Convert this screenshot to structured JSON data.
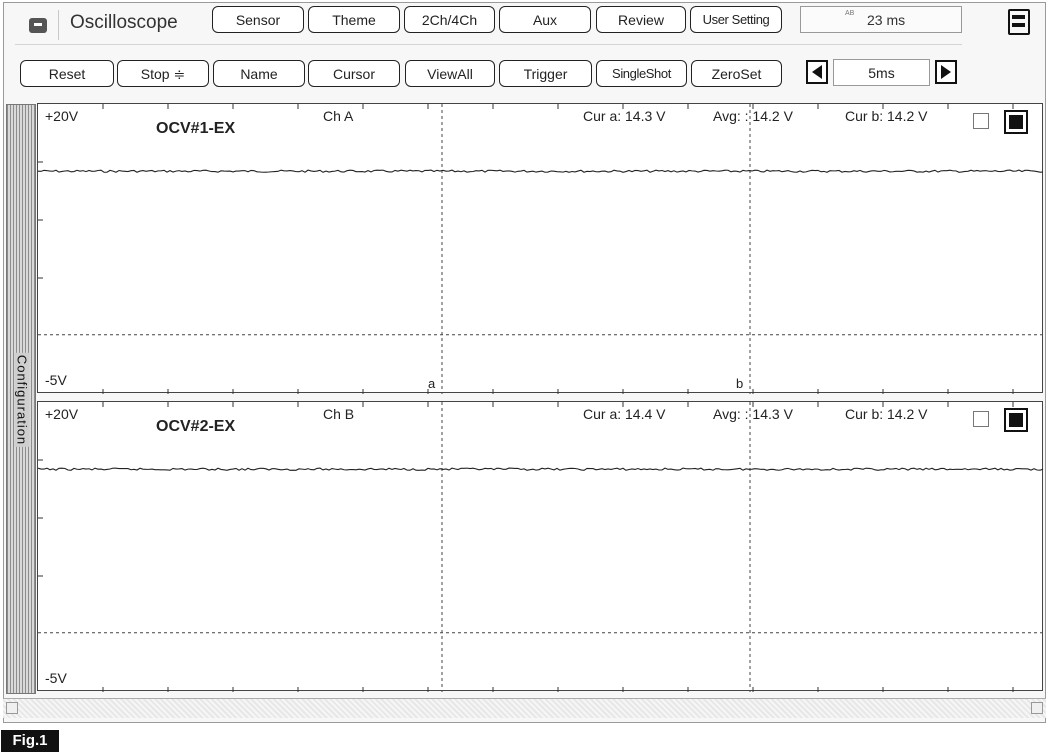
{
  "app": {
    "title": "Oscilloscope"
  },
  "toolbar_top": [
    {
      "id": "sensor",
      "label": "Sensor"
    },
    {
      "id": "theme",
      "label": "Theme"
    },
    {
      "id": "2ch4ch",
      "label": "2Ch/4Ch"
    },
    {
      "id": "aux",
      "label": "Aux"
    },
    {
      "id": "review",
      "label": "Review"
    },
    {
      "id": "user-setting",
      "label": "User Setting"
    }
  ],
  "time_readout": {
    "prefix": "AB",
    "value": "23 ms"
  },
  "toolbar_bottom": [
    {
      "id": "reset",
      "label": "Reset"
    },
    {
      "id": "stop",
      "label": "Stop ≑"
    },
    {
      "id": "name",
      "label": "Name"
    },
    {
      "id": "cursor",
      "label": "Cursor"
    },
    {
      "id": "viewall",
      "label": "ViewAll"
    },
    {
      "id": "trigger",
      "label": "Trigger"
    },
    {
      "id": "singleshot",
      "label": "SingleShot"
    },
    {
      "id": "zeroset",
      "label": "ZeroSet"
    }
  ],
  "timebase": {
    "value": "5ms"
  },
  "sidebar": {
    "label": "Configuration"
  },
  "channels": [
    {
      "name": "OCV#1-EX",
      "channel": "Ch A",
      "ymax": "+20V",
      "ymin": "-5V",
      "cur_a": "Cur a: 14.3 V",
      "avg": "Avg: : 14.2 V",
      "cur_b": "Cur b: 14.2 V",
      "cursor_a_label": "a",
      "cursor_b_label": "b",
      "signal_level": 14.3
    },
    {
      "name": "OCV#2-EX",
      "channel": "Ch B",
      "ymax": "+20V",
      "ymin": "-5V",
      "cur_a": "Cur a: 14.4 V",
      "avg": "Avg: : 14.3 V",
      "cur_b": "Cur b: 14.2 V",
      "cursor_a_label": "",
      "cursor_b_label": "",
      "signal_level": 14.3
    }
  ],
  "figure_label": "Fig.1"
}
